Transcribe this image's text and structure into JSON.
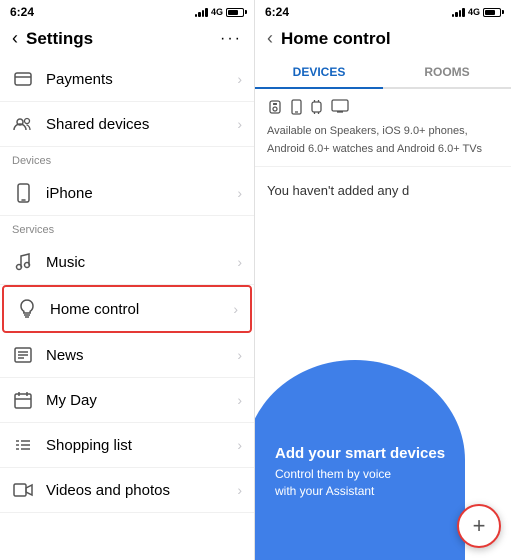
{
  "left": {
    "statusBar": {
      "time": "6:24",
      "signal": "4G"
    },
    "header": {
      "title": "Settings",
      "backLabel": "‹",
      "moreLabel": "···"
    },
    "sections": [
      {
        "label": "",
        "items": [
          {
            "id": "payments",
            "icon": "card",
            "text": "Payments",
            "hasChevron": true
          },
          {
            "id": "shared-devices",
            "icon": "people",
            "text": "Shared devices",
            "hasChevron": true
          }
        ]
      },
      {
        "label": "Devices",
        "items": [
          {
            "id": "iphone",
            "icon": "phone",
            "text": "iPhone",
            "hasChevron": true
          }
        ]
      },
      {
        "label": "Services",
        "items": [
          {
            "id": "music",
            "icon": "music",
            "text": "Music",
            "hasChevron": true
          },
          {
            "id": "home-control",
            "icon": "lightbulb",
            "text": "Home control",
            "hasChevron": true,
            "highlighted": true
          },
          {
            "id": "news",
            "icon": "news",
            "text": "News",
            "hasChevron": true
          },
          {
            "id": "my-day",
            "icon": "calendar",
            "text": "My Day",
            "hasChevron": true
          },
          {
            "id": "shopping-list",
            "icon": "list",
            "text": "Shopping list",
            "hasChevron": true
          },
          {
            "id": "videos-photos",
            "icon": "video",
            "text": "Videos and photos",
            "hasChevron": true
          }
        ]
      }
    ]
  },
  "right": {
    "statusBar": {
      "time": "6:24",
      "signal": "4G"
    },
    "header": {
      "backLabel": "‹",
      "title": "Home control"
    },
    "tabs": [
      {
        "id": "devices",
        "label": "DEVICES",
        "active": true
      },
      {
        "id": "rooms",
        "label": "ROOMS",
        "active": false
      }
    ],
    "devicesInfo": {
      "description": "Available on Speakers, iOS 9.0+ phones, Android 6.0+ watches and Android 6.0+ TVs"
    },
    "emptyState": {
      "message": "You haven't added any d"
    },
    "cta": {
      "title": "Add your smart devices",
      "subtitle": "Control them by voice\nwith your Assistant"
    },
    "fab": {
      "label": "+"
    }
  }
}
